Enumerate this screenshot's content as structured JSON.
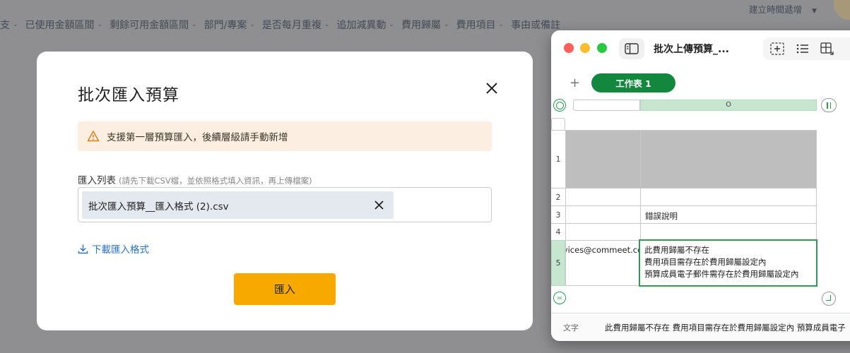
{
  "background": {
    "filters": [
      "支",
      "已使用金額區間",
      "剩餘可用金額區間",
      "部門/專案",
      "是否每月重複",
      "追加減異動",
      "費用歸屬",
      "費用項目",
      "事由或備註"
    ],
    "sort_label": "建立時間遞增"
  },
  "modal": {
    "title": "批次匯入預算",
    "notice": "支援第一層預算匯入，後續層級請手動新增",
    "import_label": "匯入列表",
    "import_hint": "(請先下載CSV檔，並依照格式填入資訊，再上傳檔案)",
    "file_name": "批次匯入預算__匯入格式 (2).csv",
    "download_label": "下載匯入格式",
    "import_button": "匯入",
    "accent_color": "#f8a900",
    "notice_bg": "#fcefe2"
  },
  "numbers": {
    "doc_title": "批次上傳預算_...",
    "sheet_tab": "工作表 1",
    "col_b_header": "O",
    "rows": [
      {
        "num": "1",
        "a": "",
        "b": ""
      },
      {
        "num": "2",
        "a": "",
        "b": ""
      },
      {
        "num": "3",
        "a": "",
        "b": "錯誤說明"
      },
      {
        "num": "4",
        "a": "",
        "b": ""
      },
      {
        "num": "5",
        "a": "services@commeet.co",
        "b_lines": [
          "此費用歸屬不存在",
          "費用項目需存在於費用歸屬設定內",
          "預算成員電子郵件需存在於費用歸屬設定內"
        ]
      }
    ],
    "formula_label": "文字",
    "formula_text": "此費用歸屬不存在 費用項目需存在於費用歸屬設定內 預算成員電子",
    "accent_color": "#14873f"
  }
}
